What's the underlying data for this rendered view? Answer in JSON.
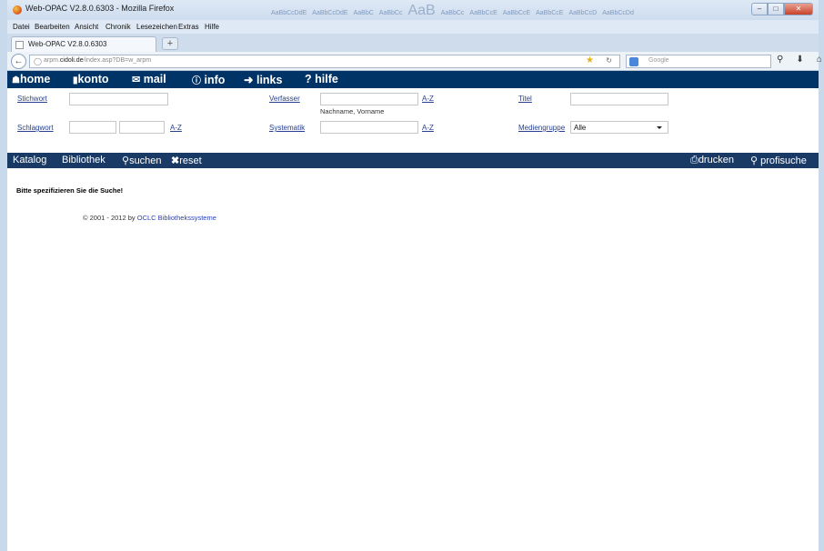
{
  "window": {
    "title": "Web-OPAC V2.8.0.6303 - Mozilla Firefox",
    "ribbon_items": [
      "AaBbCcDdE",
      "AaBbCcDdE",
      "AaBbC",
      "AaBbCc",
      "AaB",
      "AaBbCc",
      "AaBbCcE",
      "AaBbCcE",
      "AaBbCcE",
      "AaBbCcD",
      "AaBbCcDd"
    ]
  },
  "menu": {
    "items": [
      "Datei",
      "Bearbeiten",
      "Ansicht",
      "Chronik",
      "Lesezeichen",
      "Extras",
      "Hilfe"
    ]
  },
  "tab": {
    "label": "Web-OPAC V2.8.0.6303",
    "new_tab": "+"
  },
  "urlbar": {
    "prefix": "arpm.",
    "domain": "cidoli.de",
    "path": "/index.asp?DB=w_arpm"
  },
  "searchbar": {
    "placeholder": "Google"
  },
  "topnav": {
    "home": "home",
    "konto": "konto",
    "mail": "mail",
    "info": "info",
    "links": "links",
    "hilfe": "? hilfe"
  },
  "form": {
    "stichwort": "Stichwort",
    "verfasser": "Verfasser",
    "verfasser_hint": "Nachname, Vorname",
    "titel": "Titel",
    "schlagwort": "Schlagwort",
    "systematik": "Systematik",
    "mediengruppe": "Mediengruppe",
    "mediengruppe_value": "Alle",
    "az": "A-Z"
  },
  "subnav": {
    "katalog": "Katalog",
    "bibliothek": "Bibliothek",
    "suchen": "suchen",
    "reset": "reset",
    "drucken": "drucken",
    "profisuche": "profisuche"
  },
  "message": "Bitte spezifizieren Sie die Suche!",
  "footer": {
    "copyright": "© 2001 - 2012 by",
    "link": "OCLC Bibliothekssysteme"
  }
}
